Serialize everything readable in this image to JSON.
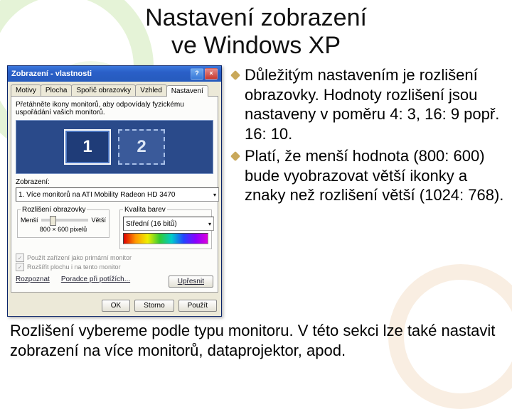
{
  "title": "Nastavení zobrazení\nve Windows XP",
  "dialog": {
    "title": "Zobrazení - vlastnosti",
    "tabs": [
      "Motivy",
      "Plocha",
      "Spořič obrazovky",
      "Vzhled",
      "Nastavení"
    ],
    "active_tab": 4,
    "hint": "Přetáhněte ikony monitorů, aby odpovídaly fyzickému uspořádání vašich monitorů.",
    "monitor_1": "1",
    "monitor_2": "2",
    "display_label": "Zobrazení:",
    "display_value": "1. Více monitorů na ATI Mobility Radeon HD 3470",
    "res_legend": "Rozlišení obrazovky",
    "res_min": "Menší",
    "res_max": "Větší",
    "res_value": "800 × 600 pixelů",
    "color_legend": "Kvalita barev",
    "color_value": "Střední (16 bitů)",
    "chk1": "Použít zařízení jako primární monitor",
    "chk2": "Rozšířit plochu i na tento monitor",
    "link_id": "Rozpoznat",
    "link_ts": "Poradce při potížích...",
    "btn_adv": "Upřesnit",
    "btn_ok": "OK",
    "btn_cancel": "Storno",
    "btn_apply": "Použít"
  },
  "bullets": {
    "b1": "Důležitým nastavením je rozlišení obrazovky. Hodnoty rozlišení jsou nastaveny v poměru 4: 3, 16: 9 popř. 16: 10.",
    "b2": "Platí, že menší hodnota (800: 600) bude vyobrazovat větší ikonky a znaky než rozlišení větší (1024: 768)."
  },
  "bottom": "Rozlišení vybereme podle typu monitoru. V této sekci lze také nastavit zobrazení na více monitorů, dataprojektor, apod."
}
